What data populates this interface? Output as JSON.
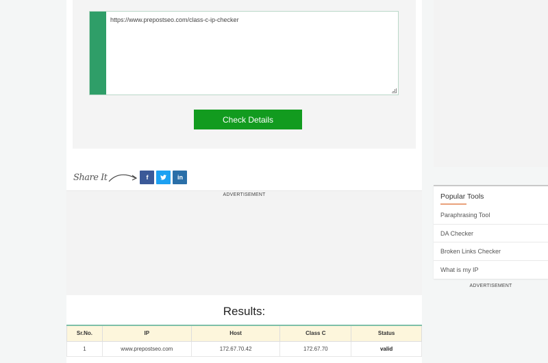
{
  "tool": {
    "url_value": "https://www.prepostseo.com/class-c-ip-checker",
    "check_button_label": "Check Details"
  },
  "share": {
    "label": "Share It",
    "buttons": [
      {
        "name": "facebook",
        "glyph": "f",
        "color": "#3b5998"
      },
      {
        "name": "twitter",
        "glyph": "🐦",
        "color": "#1da1f2"
      },
      {
        "name": "linkedin",
        "glyph": "in",
        "color": "#2a6fa8"
      }
    ]
  },
  "ads": {
    "main_label": "ADVERTISEMENT",
    "sidebar_label": "ADVERTISEMENT"
  },
  "results": {
    "title": "Results:",
    "columns": [
      "Sr.No.",
      "IP",
      "Host",
      "Class C",
      "Status"
    ],
    "rows": [
      {
        "sr": "1",
        "ip": "www.prepostseo.com",
        "host": "172.67.70.42",
        "class_c": "172.67.70",
        "status": "valid"
      }
    ]
  },
  "sidebar": {
    "title": "Popular Tools",
    "items": [
      "Paraphrasing Tool",
      "DA Checker",
      "Broken Links Checker",
      "What is my IP"
    ]
  },
  "colors": {
    "accent_green": "#129b1f",
    "input_bar_green": "#2f9e68",
    "table_header_bg": "#fdf6dc",
    "sidebar_underline": "#e9a17a"
  }
}
